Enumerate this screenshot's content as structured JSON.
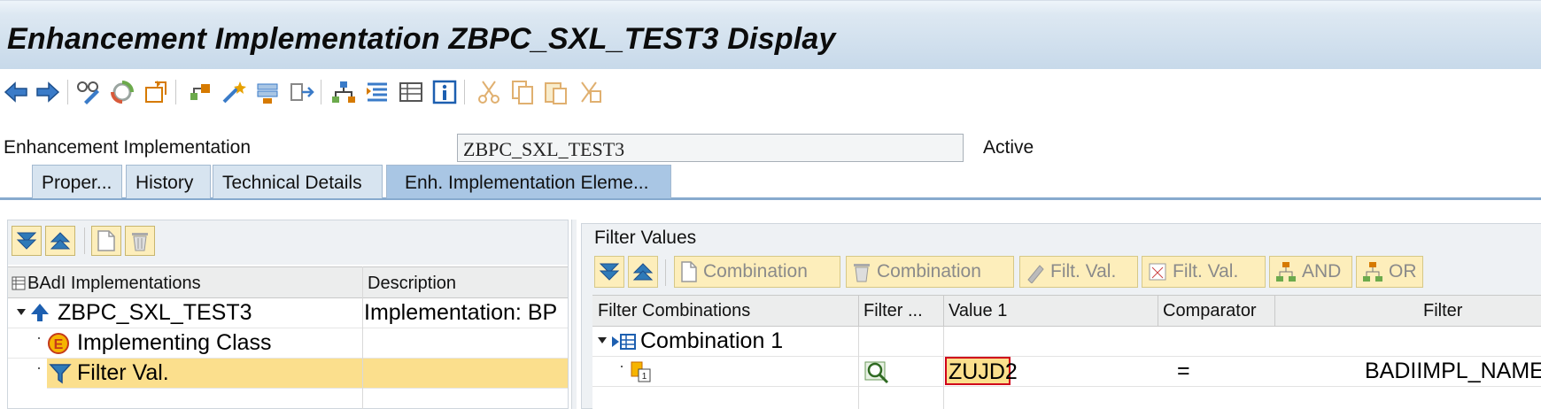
{
  "window": {
    "title": "Enhancement Implementation ZBPC_SXL_TEST3 Display"
  },
  "toolbar": {
    "icons": [
      "back-arrow-icon",
      "forward-arrow-icon",
      "glasses-pencil-icon",
      "activate-icon",
      "other-object-icon",
      "where-used-icon",
      "magic-wand-icon",
      "stack-icon",
      "move-icon",
      "hierarchy-icon",
      "indent-icon",
      "list-view-icon",
      "info-icon",
      "cut-icon",
      "copy-icon",
      "paste-icon",
      "undo-cut-icon"
    ]
  },
  "header": {
    "label": "Enhancement Implementation",
    "value": "ZBPC_SXL_TEST3",
    "status": "Active"
  },
  "tabs": [
    {
      "label": "Proper...",
      "active": false
    },
    {
      "label": "History",
      "active": false
    },
    {
      "label": "Technical Details",
      "active": false
    },
    {
      "label": "Enh. Implementation Eleme...",
      "active": true
    }
  ],
  "left_tree": {
    "columns": [
      "BAdI Implementations",
      "Description"
    ],
    "rows": [
      {
        "name": "ZBPC_SXL_TEST3",
        "description": "Implementation: BP",
        "icon": "badi-impl-icon",
        "expander": "triangle-down"
      },
      {
        "name": "Implementing Class",
        "description": "",
        "icon": "class-icon",
        "expander": "dot"
      },
      {
        "name": "Filter Val.",
        "description": "",
        "icon": "filter-icon",
        "expander": "dot",
        "selected": true
      }
    ]
  },
  "filter_panel": {
    "title": "Filter Values",
    "buttons": [
      {
        "label": "Combination",
        "icon": "new-doc-icon"
      },
      {
        "label": "Combination",
        "icon": "trash-icon"
      },
      {
        "label": "Filt. Val.",
        "icon": "pencil-icon"
      },
      {
        "label": "Filt. Val.",
        "icon": "delete-value-icon"
      },
      {
        "label": "AND",
        "icon": "and-hierarchy-icon"
      },
      {
        "label": "OR",
        "icon": "or-hierarchy-icon"
      }
    ],
    "columns": [
      "Filter Combinations",
      "Filter ...",
      "Value 1",
      "Comparator",
      "Filter"
    ],
    "rows": [
      {
        "combination": "Combination 1",
        "filter_icon": "",
        "value1": "",
        "comparator": "",
        "filter": ""
      },
      {
        "combination": "",
        "filter_icon": "magnifier-icon",
        "value1": "ZUJD2",
        "comparator": "=",
        "filter": "BADIIMPL_NAME"
      }
    ]
  },
  "colors": {
    "title_bar": "#c7d9ea",
    "selection": "#fbdf8d",
    "button_yellow": "#fdeebb",
    "tab_active": "#a9c6e4",
    "tab": "#d7e4f0",
    "highlight_border": "#d0021b"
  }
}
